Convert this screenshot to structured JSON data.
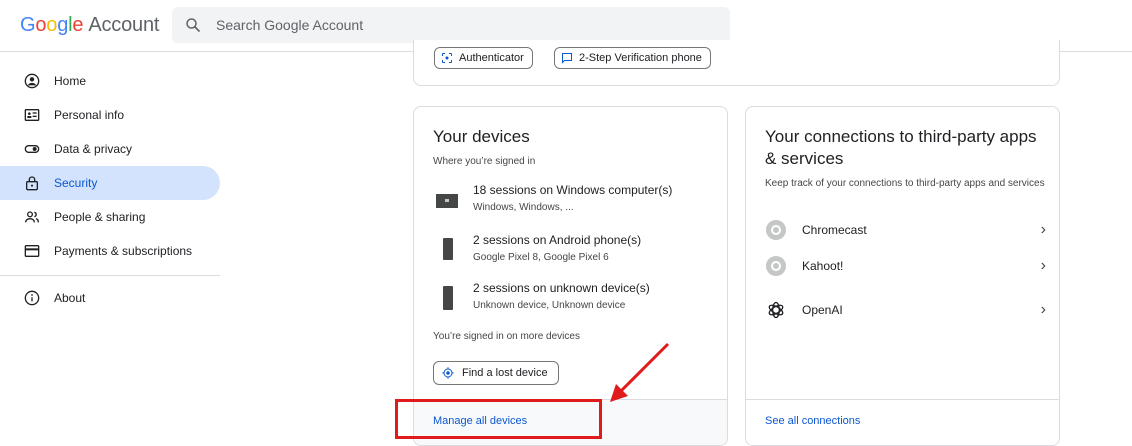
{
  "header": {
    "logo_google": [
      "G",
      "o",
      "o",
      "g",
      "l",
      "e"
    ],
    "logo_account": "Account",
    "search_placeholder": "Search Google Account"
  },
  "sidebar": {
    "items": [
      {
        "label": "Home",
        "icon": "account-circle-icon"
      },
      {
        "label": "Personal info",
        "icon": "id-card-icon"
      },
      {
        "label": "Data & privacy",
        "icon": "toggle-icon"
      },
      {
        "label": "Security",
        "icon": "lock-icon",
        "active": true
      },
      {
        "label": "People & sharing",
        "icon": "people-icon"
      },
      {
        "label": "Payments & subscriptions",
        "icon": "credit-card-icon"
      },
      {
        "label": "About",
        "icon": "info-icon"
      }
    ]
  },
  "top_card": {
    "chips": [
      {
        "label": "Authenticator",
        "icon": "authenticator-icon"
      },
      {
        "label": "2-Step Verification phone",
        "icon": "message-icon"
      }
    ]
  },
  "devices_card": {
    "title": "Your devices",
    "subtitle": "Where you’re signed in",
    "devices": [
      {
        "title": "18 sessions on Windows computer(s)",
        "sub": "Windows, Windows, ...",
        "icon": "computer-icon"
      },
      {
        "title": "2 sessions on Android phone(s)",
        "sub": "Google Pixel 8, Google Pixel 6",
        "icon": "phone-icon"
      },
      {
        "title": "2 sessions on unknown device(s)",
        "sub": "Unknown device, Unknown device",
        "icon": "phone-icon"
      }
    ],
    "more_text": "You’re signed in on more devices",
    "find_button": "Find a lost device",
    "footer_link": "Manage all devices"
  },
  "connections_card": {
    "title": "Your connections to third-party apps & services",
    "subtitle": "Keep track of your connections to third-party apps and services",
    "items": [
      {
        "label": "Chromecast",
        "icon": "app-placeholder-icon"
      },
      {
        "label": "Kahoot!",
        "icon": "app-placeholder-icon"
      },
      {
        "label": "OpenAI",
        "icon": "openai-icon"
      }
    ],
    "footer_link": "See all connections"
  },
  "colors": {
    "accent": "#0b57d0",
    "active_bg": "#d3e3fd",
    "annotation_red": "#e01b1b"
  }
}
